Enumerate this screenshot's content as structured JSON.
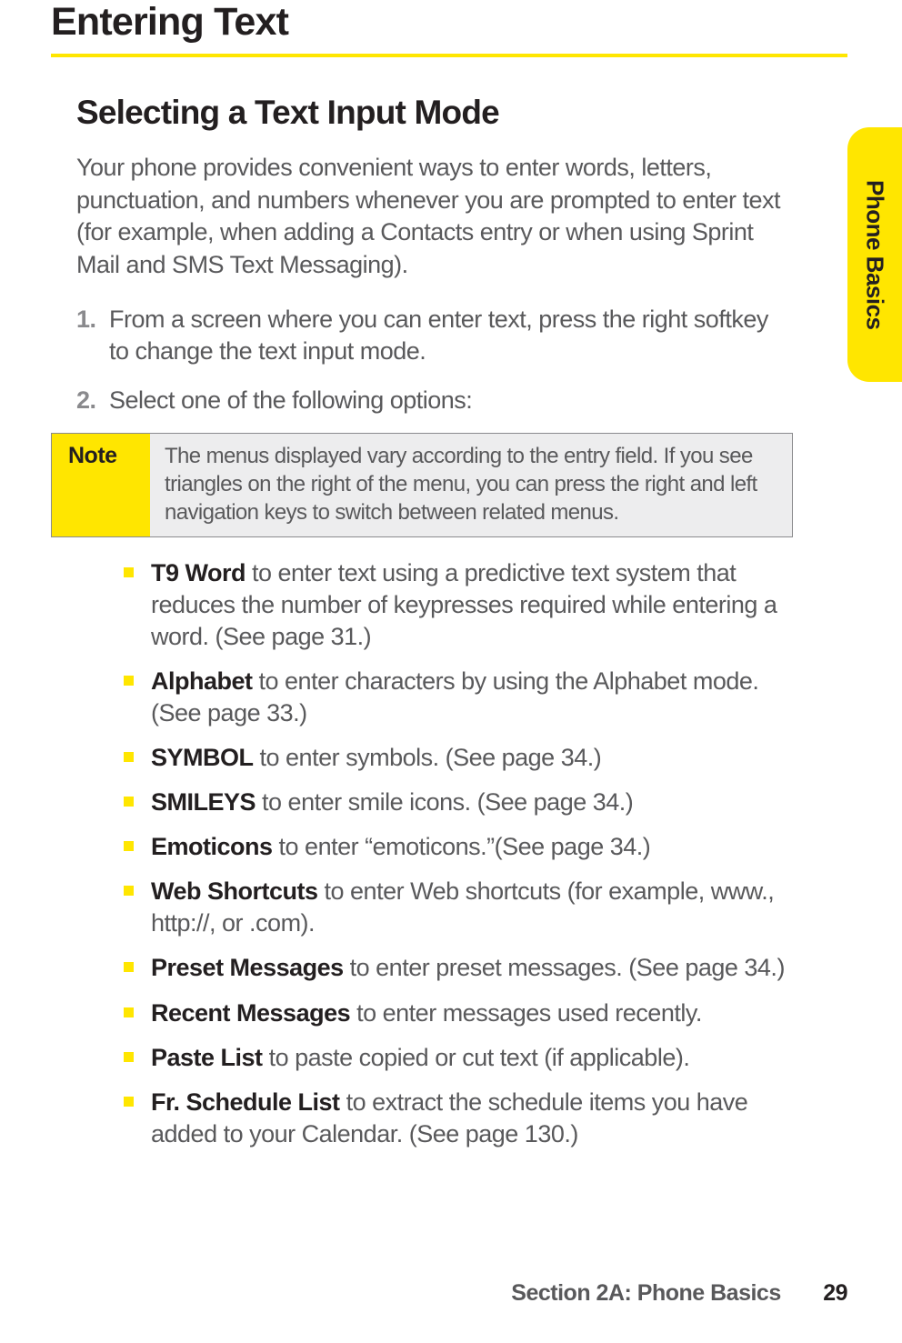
{
  "heading1": "Entering Text",
  "sideTab": "Phone Basics",
  "heading2": "Selecting a Text Input Mode",
  "introPara": "Your phone provides convenient ways to enter words, letters, punctuation, and numbers whenever you are prompted to enter text (for example, when adding a Contacts entry or when using Sprint Mail and SMS Text Messaging).",
  "step1Num": "1.",
  "step1Text": "From a screen where you can enter text, press the right softkey to change the text input mode.",
  "step2Num": "2.",
  "step2Text": "Select one of the following options:",
  "noteLabel": "Note",
  "noteBody": "The menus displayed vary according to the entry field. If you see triangles on the right of the menu, you can press the right and left navigation keys to switch between related menus.",
  "items": [
    {
      "bold": "T9 Word",
      "rest": " to enter text using a predictive text system that reduces the number of keypresses required while entering a word. (See page 31.)"
    },
    {
      "bold": "Alphabet",
      "rest": " to enter characters by using the Alphabet mode. (See page 33.)"
    },
    {
      "bold": "SYMBOL",
      "rest": " to enter symbols. (See page 34.)"
    },
    {
      "bold": "SMILEYS",
      "rest": " to enter smile icons. (See page 34.)"
    },
    {
      "bold": "Emoticons",
      "rest": " to enter “emoticons.”(See page 34.)"
    },
    {
      "bold": "Web Shortcuts",
      "rest": " to enter Web shortcuts (for example, www., http://, or .com)."
    },
    {
      "bold": "Preset Messages",
      "rest": " to enter preset messages. (See page 34.)"
    },
    {
      "bold": "Recent Messages",
      "rest": " to enter messages used recently."
    },
    {
      "bold": "Paste List",
      "rest": " to paste copied or cut text (if applicable)."
    },
    {
      "bold": "Fr. Schedule List",
      "rest": " to extract the schedule items you have added to your Calendar. (See page 130.)"
    }
  ],
  "footerSection": "Section 2A: Phone Basics",
  "footerPage": "29"
}
